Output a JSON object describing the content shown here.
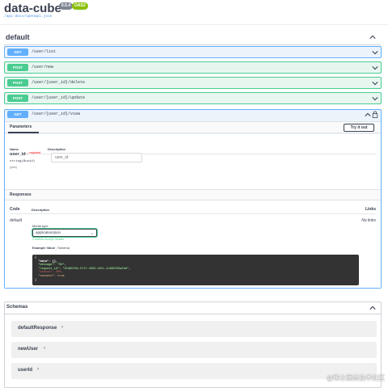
{
  "header": {
    "title": "data-cube",
    "version_badge": "0.5.4",
    "oas_badge": "OAS3",
    "spec_link": "/api-docs/openapi.json"
  },
  "section": {
    "title": "default"
  },
  "operations": [
    {
      "method": "GET",
      "path": "/user/list"
    },
    {
      "method": "POST",
      "path": "/user/new"
    },
    {
      "method": "POST",
      "path": "/user/{user_id}/delete"
    },
    {
      "method": "POST",
      "path": "/user/{user_id}/update"
    }
  ],
  "expanded": {
    "method": "GET",
    "path": "/user/{user_id}/view",
    "params_tab": "Parameters",
    "try_button": "Try it out",
    "col_name": "Name",
    "col_description": "Description",
    "param": {
      "name": "user_id",
      "required_star": "*",
      "required_label": "required",
      "type": "string($uuid)",
      "location": "(path)",
      "placeholder": "user_id"
    },
    "responses_title": "Responses",
    "resp_col_code": "Code",
    "resp_col_description": "Description",
    "resp_col_links": "Links",
    "response": {
      "code": "default",
      "no_links": "No links",
      "media_type_label": "Media type",
      "media_type": "application/json",
      "controls_hint": "Controls Accept header.",
      "example_tab": "Example Value",
      "schema_tab": "Schema",
      "example_lines": [
        "{",
        "  \"data\": {},",
        "  \"message\": \"OK\",",
        "  \"request_id\": \"3fa85f64-5717-4562-b3fc-2c963f66afa6\",",
        "  \"status\": 200,",
        "  \"success\": true",
        "}"
      ]
    }
  },
  "schemas": {
    "title": "Schemas",
    "items": [
      "defaultResponse",
      "newUser",
      "userId"
    ]
  },
  "watermark": "@稀土掘金技术社区",
  "colors": {
    "get": "#61affe",
    "post": "#49cc90",
    "text": "#3b4151"
  }
}
